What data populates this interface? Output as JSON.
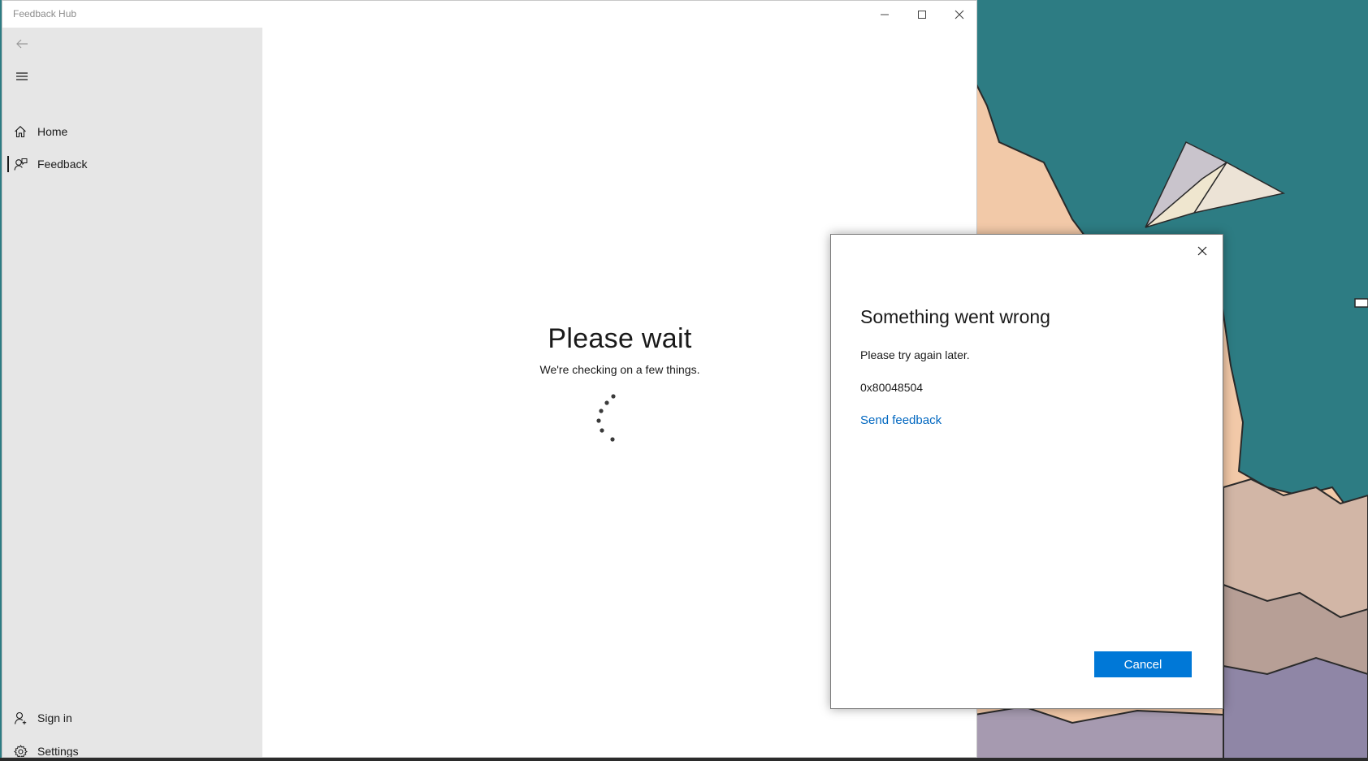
{
  "window": {
    "title": "Feedback Hub"
  },
  "sidebar": {
    "items": [
      {
        "label": "Home",
        "icon": "home-icon"
      },
      {
        "label": "Feedback",
        "icon": "feedback-icon",
        "selected": true
      }
    ],
    "footer": [
      {
        "label": "Sign in",
        "icon": "person-icon"
      },
      {
        "label": "Settings",
        "icon": "gear-icon"
      }
    ]
  },
  "main": {
    "title": "Please wait",
    "subtitle": "We're checking on a few things."
  },
  "dialog": {
    "title": "Something went wrong",
    "message": "Please try again later.",
    "error_code": "0x80048504",
    "link_label": "Send feedback",
    "cancel_label": "Cancel"
  },
  "colors": {
    "accent": "#0078d7",
    "link": "#0067c0",
    "sidebar_bg": "#e6e6e6",
    "wallpaper_teal": "#2d7c83",
    "wallpaper_peach": "#f2c9a8"
  }
}
